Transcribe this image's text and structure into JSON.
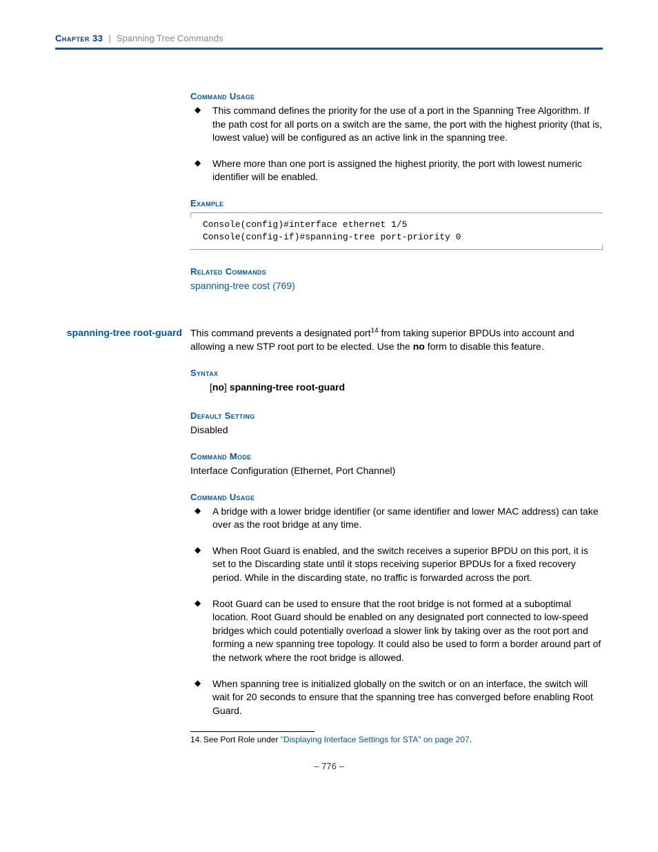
{
  "header": {
    "chapter_label": "Chapter 33",
    "separator": "|",
    "chapter_title": "Spanning Tree Commands"
  },
  "sec1": {
    "cmd_usage_heading": "Command Usage",
    "bullets": [
      "This command defines the priority for the use of a port in the Spanning Tree Algorithm. If the path cost for all ports on a switch are the same, the port with the highest priority (that is, lowest value) will be configured as an active link in the spanning tree.",
      "Where more than one port is assigned the highest priority, the port with lowest numeric identifier will be enabled."
    ],
    "example_heading": "Example",
    "example_code": "Console(config)#interface ethernet 1/5\nConsole(config-if)#spanning-tree port-priority 0",
    "related_heading": "Related Commands",
    "related_link": "spanning-tree cost (769)"
  },
  "sec2": {
    "sidebar_label": "spanning-tree root-guard",
    "intro_p1": "This command prevents a designated port",
    "intro_sup": "14",
    "intro_p2": " from taking superior BPDUs into account and allowing a new STP root port to be elected. Use the ",
    "intro_no": "no",
    "intro_p3": " form to disable this feature.",
    "syntax_heading": "Syntax",
    "syntax_no": "no",
    "syntax_cmd": "spanning-tree root-guard",
    "default_heading": "Default Setting",
    "default_value": "Disabled",
    "mode_heading": "Command Mode",
    "mode_value": "Interface Configuration (Ethernet, Port Channel)",
    "cmd_usage_heading": "Command Usage",
    "bullets": [
      "A bridge with a lower bridge identifier (or same identifier and lower MAC address) can take over as the root bridge at any time.",
      "When Root Guard is enabled, and the switch receives a superior BPDU on this port, it is set to the Discarding state until it stops receiving superior BPDUs for a fixed recovery period. While in the discarding state, no traffic is forwarded across the port.",
      "Root Guard can be used to ensure that the root bridge is not formed at a suboptimal location. Root Guard should be enabled on any designated port connected to low-speed bridges which could potentially overload a slower link by taking over as the root port and forming a new spanning tree topology. It could also be used to form a border around part of the network where the root bridge is allowed.",
      "When spanning tree is initialized globally on the switch or on an interface, the switch will wait for 20 seconds to ensure that the spanning tree has converged before enabling Root Guard."
    ]
  },
  "footnote": {
    "num": "14.",
    "pre": "See Port Role under ",
    "link": "\"Displaying Interface Settings for STA\" on page 207",
    "post": "."
  },
  "page_number": "–  776  –"
}
